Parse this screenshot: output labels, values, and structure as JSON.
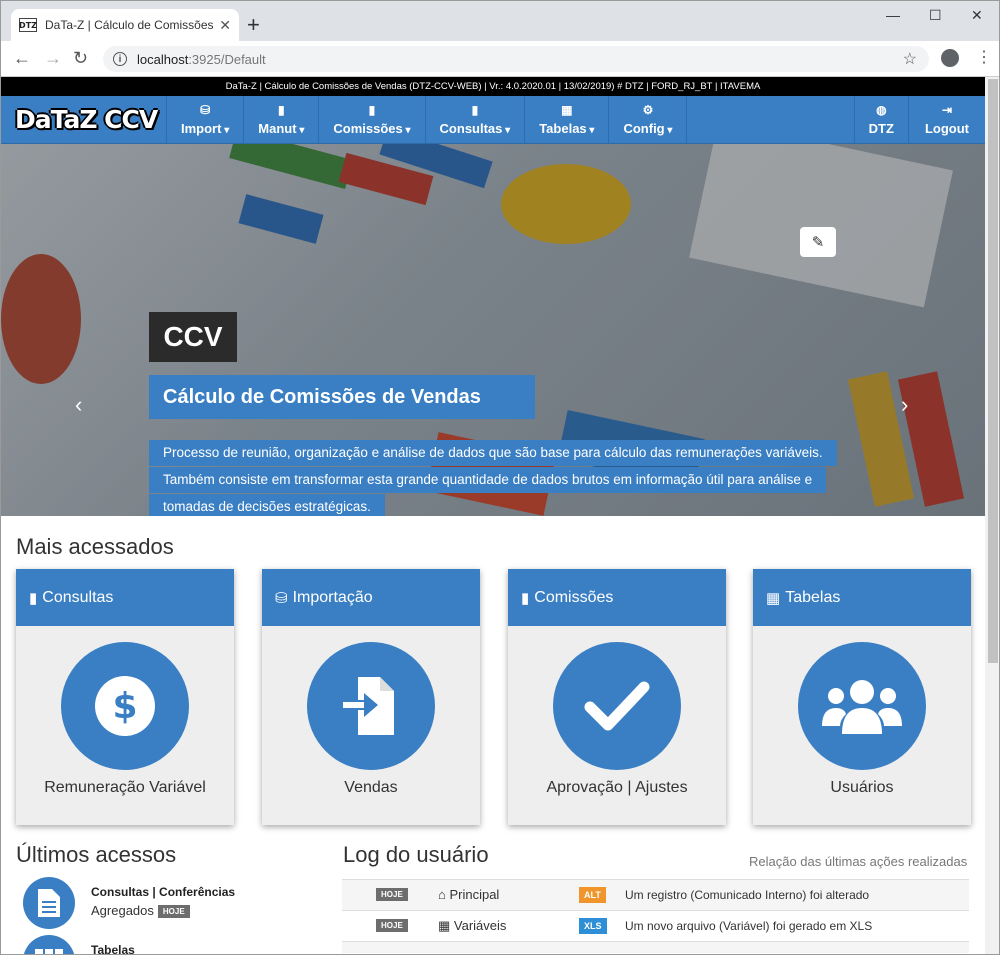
{
  "browser": {
    "tab_title": "DaTa-Z | Cálculo de Comissões de Vendas",
    "favicon_text": "DTZ",
    "url_host": "localhost",
    "url_path": ":3925/Default"
  },
  "infobar": "DaTa-Z | Cálculo de Comissões de Vendas (DTZ-CCV-WEB) | Vr.: 4.0.2020.01 | 13/02/2019) # DTZ | FORD_RJ_BT | ITAVEMA",
  "navbar": {
    "logo": "DaTaZ CCV",
    "items": [
      {
        "label": "Import",
        "icon": "database-icon"
      },
      {
        "label": "Manut",
        "icon": "file-icon"
      },
      {
        "label": "Comissões",
        "icon": "file-dollar-icon"
      },
      {
        "label": "Consultas",
        "icon": "file-text-icon"
      },
      {
        "label": "Tabelas",
        "icon": "table-icon"
      },
      {
        "label": "Config",
        "icon": "gear-icon"
      }
    ],
    "right": [
      {
        "label": "DTZ",
        "icon": "globe-icon"
      },
      {
        "label": "Logout",
        "icon": "sign-out-icon"
      }
    ]
  },
  "carousel": {
    "badge": "CCV",
    "title": "Cálculo de Comissões de Vendas",
    "lines": [
      "Processo de reunião, organização e análise de dados que são base para cálculo das remunerações variáveis.",
      "Também consiste em transformar esta grande quantidade de dados brutos em informação útil para análise e",
      "tomadas de decisões estratégicas."
    ]
  },
  "most_accessed": {
    "title": "Mais acessados",
    "cards": [
      {
        "head": "Consultas",
        "label": "Remuneração Variável",
        "icon": "dollar-icon"
      },
      {
        "head": "Importação",
        "label": "Vendas",
        "icon": "import-file-icon"
      },
      {
        "head": "Comissões",
        "label": "Aprovação | Ajustes",
        "icon": "check-icon"
      },
      {
        "head": "Tabelas",
        "label": "Usuários",
        "icon": "users-icon"
      }
    ]
  },
  "last_access": {
    "title": "Últimos acessos",
    "items": [
      {
        "title": "Consultas | Conferências",
        "sub": "Agregados",
        "badge": "HOJE"
      },
      {
        "title": "Tabelas",
        "sub": "",
        "badge": ""
      }
    ]
  },
  "log": {
    "title": "Log do usuário",
    "caption": "Relação das últimas ações realizadas",
    "rows": [
      {
        "date": "HOJE",
        "page": "Principal",
        "page_icon": "home-icon",
        "type": "ALT",
        "type_color": "#f0952b",
        "msg": "Um registro (Comunicado Interno) foi alterado"
      },
      {
        "date": "HOJE",
        "page": "Variáveis",
        "page_icon": "table-icon",
        "type": "XLS",
        "type_color": "#2f8fd6",
        "msg": "Um novo arquivo (Variável) foi gerado em XLS"
      }
    ]
  }
}
